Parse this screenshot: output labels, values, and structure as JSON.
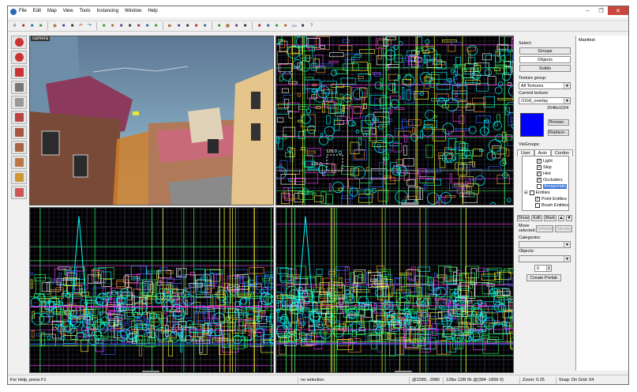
{
  "menu": [
    "File",
    "Edit",
    "Map",
    "View",
    "Tools",
    "Instancing",
    "Window",
    "Help"
  ],
  "window_controls": {
    "minimize": "–",
    "restore": "❐",
    "close": "✕"
  },
  "toolbar_icons": [
    "grid-icon",
    "grid-toggle-icon",
    "grid-size-down-icon",
    "grid-size-up-icon",
    "camera-icon",
    "texture-lock-icon",
    "texture-scale-icon",
    "undo-icon",
    "redo-icon",
    "carve-icon",
    "group-icon",
    "ungroup-icon",
    "hide-icon",
    "unhide-icon",
    "to-world-icon",
    "to-entity-icon",
    "run-map-icon",
    "vertex-icon",
    "clip-icon",
    "decal-icon",
    "overlay-icon",
    "sel-icon",
    "select-all-icon",
    "quick-hide-icon",
    "hide-unselected-icon",
    "wireframe-icon",
    "flat-icon",
    "texture-icon",
    "lightmap-icon",
    "cm-icon",
    "lighting-preview-icon",
    "help-icon"
  ],
  "left_tools": [
    "selection-tool-icon",
    "magnify-tool-icon",
    "camera-tool-icon",
    "entity-tool-icon",
    "block-tool-icon",
    "texture-app-icon",
    "apply-texture-icon",
    "decal-tool-icon",
    "overlay-tool-icon",
    "clip-tool-icon",
    "vertex-tool-icon"
  ],
  "viewports": {
    "camera_label": "camera",
    "top_label_a": "128.0",
    "top_label_b": "128.0"
  },
  "select_panel": {
    "label": "Select:",
    "groups": "Groups",
    "objects": "Objects",
    "solids": "Solids"
  },
  "texture": {
    "group_label": "Texture group:",
    "group_value": "All Textures",
    "current_label": "Current texture:",
    "current_value": "/12x6_overlay",
    "size": "2048x1024",
    "browse": "Browse...",
    "replace": "Replace...",
    "swatch_color": "#0000ff"
  },
  "visgroups": {
    "label": "VisGroups:",
    "tabs": [
      "User",
      "Auto",
      "Cordon"
    ],
    "items": [
      {
        "label": "Light",
        "checked": true
      },
      {
        "label": "Skip",
        "checked": true
      },
      {
        "label": "Hint",
        "checked": true
      },
      {
        "label": "Occluders",
        "checked": true
      },
      {
        "label": "Areaportals",
        "checked": false,
        "highlight": true
      },
      {
        "label": "Entities",
        "checked": false,
        "expander": true
      },
      {
        "label": "Point Entities",
        "checked": true
      },
      {
        "label": "Brush Entities",
        "checked": false
      }
    ],
    "buttons": {
      "show": "Show",
      "edit": "Edit",
      "mark": "Mark",
      "up": "▲",
      "down": "▼"
    }
  },
  "move_selected": {
    "label": "Move selected:",
    "to_world": "ToWorld",
    "to_entity": "ToEntity"
  },
  "categories_label": "Categories:",
  "objects_label": "Objects:",
  "objects_count": "0",
  "create_prefab": "Create Prefab",
  "manifest": {
    "title": "Manifest"
  },
  "status": {
    "help": "For Help, press F1",
    "selection": "no selection.",
    "coords": "@2289, -2980",
    "size": "128w 128l 0h @(384 -1856 0)",
    "zoom": "Zoom: 0.25",
    "snap": "Snap: On Grid: 64"
  }
}
